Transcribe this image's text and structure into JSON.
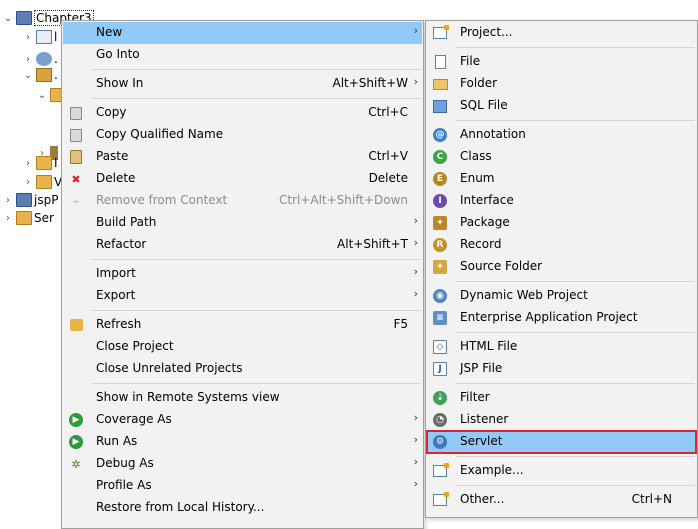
{
  "tree": {
    "items": [
      {
        "label": "Chapter3"
      },
      {
        "label": "l"
      },
      {
        "label": "."
      },
      {
        "label": "."
      },
      {
        "label": "."
      },
      {
        "label": "I"
      },
      {
        "label": "I"
      },
      {
        "label": "V"
      },
      {
        "label": "jspP"
      },
      {
        "label": "Ser"
      }
    ]
  },
  "main_menu": {
    "items": [
      {
        "label": "New",
        "shortcut": "",
        "icon": "none"
      },
      {
        "label": "Go Into",
        "shortcut": "",
        "icon": "none"
      },
      {
        "label": "Show In",
        "shortcut": "Alt+Shift+W",
        "icon": "none"
      },
      {
        "label": "Copy",
        "shortcut": "Ctrl+C",
        "icon": "copy-icon"
      },
      {
        "label": "Copy Qualified Name",
        "shortcut": "",
        "icon": "copy-icon"
      },
      {
        "label": "Paste",
        "shortcut": "Ctrl+V",
        "icon": "paste-icon"
      },
      {
        "label": "Delete",
        "shortcut": "Delete",
        "icon": "delete-icon"
      },
      {
        "label": "Remove from Context",
        "shortcut": "Ctrl+Alt+Shift+Down",
        "icon": "remove-context-icon"
      },
      {
        "label": "Build Path",
        "shortcut": "",
        "icon": "none"
      },
      {
        "label": "Refactor",
        "shortcut": "Alt+Shift+T",
        "icon": "none"
      },
      {
        "label": "Import",
        "shortcut": "",
        "icon": "none"
      },
      {
        "label": "Export",
        "shortcut": "",
        "icon": "none"
      },
      {
        "label": "Refresh",
        "shortcut": "F5",
        "icon": "refresh-icon"
      },
      {
        "label": "Close Project",
        "shortcut": "",
        "icon": "none"
      },
      {
        "label": "Close Unrelated Projects",
        "shortcut": "",
        "icon": "none"
      },
      {
        "label": "Show in Remote Systems view",
        "shortcut": "",
        "icon": "none"
      },
      {
        "label": "Coverage As",
        "shortcut": "",
        "icon": "coverage-icon"
      },
      {
        "label": "Run As",
        "shortcut": "",
        "icon": "run-icon"
      },
      {
        "label": "Debug As",
        "shortcut": "",
        "icon": "debug-icon"
      },
      {
        "label": "Profile As",
        "shortcut": "",
        "icon": "none"
      },
      {
        "label": "Restore from Local History...",
        "shortcut": "",
        "icon": "none"
      }
    ]
  },
  "new_submenu": {
    "items": [
      {
        "label": "Project...",
        "shortcut": "",
        "icon": "new-project-icon"
      },
      {
        "label": "File",
        "shortcut": "",
        "icon": "file-icon"
      },
      {
        "label": "Folder",
        "shortcut": "",
        "icon": "folder-icon"
      },
      {
        "label": "SQL File",
        "shortcut": "",
        "icon": "sql-file-icon"
      },
      {
        "label": "Annotation",
        "shortcut": "",
        "icon": "annotation-icon"
      },
      {
        "label": "Class",
        "shortcut": "",
        "icon": "class-icon"
      },
      {
        "label": "Enum",
        "shortcut": "",
        "icon": "enum-icon"
      },
      {
        "label": "Interface",
        "shortcut": "",
        "icon": "interface-icon"
      },
      {
        "label": "Package",
        "shortcut": "",
        "icon": "package-icon"
      },
      {
        "label": "Record",
        "shortcut": "",
        "icon": "record-icon"
      },
      {
        "label": "Source Folder",
        "shortcut": "",
        "icon": "source-folder-icon"
      },
      {
        "label": "Dynamic Web Project",
        "shortcut": "",
        "icon": "dynamic-web-project-icon"
      },
      {
        "label": "Enterprise Application Project",
        "shortcut": "",
        "icon": "enterprise-app-icon"
      },
      {
        "label": "HTML File",
        "shortcut": "",
        "icon": "html-file-icon"
      },
      {
        "label": "JSP File",
        "shortcut": "",
        "icon": "jsp-file-icon"
      },
      {
        "label": "Filter",
        "shortcut": "",
        "icon": "filter-icon"
      },
      {
        "label": "Listener",
        "shortcut": "",
        "icon": "listener-icon"
      },
      {
        "label": "Servlet",
        "shortcut": "",
        "icon": "servlet-icon"
      },
      {
        "label": "Example...",
        "shortcut": "",
        "icon": "example-icon"
      },
      {
        "label": "Other...",
        "shortcut": "Ctrl+N",
        "icon": "other-icon"
      }
    ]
  },
  "colors": {
    "highlight": "#91c9f7",
    "menu_background": "#f2f2f2",
    "annotation_box": "#d9252b"
  }
}
